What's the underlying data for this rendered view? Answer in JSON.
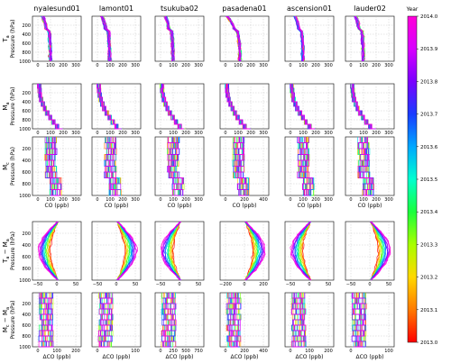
{
  "chart_data": {
    "type": "line",
    "sites": [
      "nyalesund01",
      "lamont01",
      "tsukuba02",
      "pasadena01",
      "ascension01",
      "lauder02"
    ],
    "rows": [
      {
        "key": "Ta",
        "ylabel_top": "T",
        "ylabel_sub": "a",
        "ylabel_main": "Pressure (hPa)",
        "xlabel": "",
        "kind": "smooth",
        "xlim": [
          [
            0,
            350
          ],
          [
            0,
            350
          ],
          [
            0,
            350
          ],
          [
            0,
            350
          ],
          [
            0,
            350
          ],
          [
            0,
            350
          ]
        ],
        "xticks": [
          [
            0,
            100,
            200,
            300
          ],
          [
            0,
            100,
            200,
            300
          ],
          [
            0,
            100,
            200,
            300
          ],
          [
            0,
            100,
            200,
            300
          ],
          [
            0,
            100,
            200,
            300
          ],
          [
            0,
            100,
            200,
            300
          ]
        ]
      },
      {
        "key": "Ma",
        "ylabel_top": "M",
        "ylabel_sub": "a",
        "ylabel_main": "Pressure (hPa)",
        "xlabel": "",
        "kind": "step",
        "xlim": [
          [
            0,
            350
          ],
          [
            0,
            350
          ],
          [
            0,
            350
          ],
          [
            0,
            350
          ],
          [
            0,
            350
          ],
          [
            0,
            350
          ]
        ],
        "xticks": [
          [
            0,
            100,
            200,
            300
          ],
          [
            0,
            100,
            200,
            300
          ],
          [
            0,
            100,
            200,
            300
          ],
          [
            0,
            100,
            200,
            300
          ],
          [
            0,
            100,
            200,
            300
          ],
          [
            0,
            100,
            200,
            300
          ]
        ]
      },
      {
        "key": "Mc",
        "ylabel_top": "M",
        "ylabel_sub": "c",
        "ylabel_main": "Pressure (hPa)",
        "xlabel": "CO (ppb)",
        "kind": "step",
        "xlim": [
          [
            0,
            350
          ],
          [
            0,
            350
          ],
          [
            0,
            350
          ],
          [
            0,
            350
          ],
          [
            0,
            350
          ],
          [
            0,
            350
          ]
        ],
        "xticks": [
          [
            "0",
            "100",
            "200",
            "300"
          ],
          [
            "0",
            "100",
            "200",
            "300"
          ],
          [
            "0",
            "100",
            "200",
            "300"
          ],
          [
            "0",
            "200",
            "400"
          ],
          [
            "0",
            "100",
            "200",
            "300"
          ],
          [
            "0",
            "100",
            "200",
            "300"
          ]
        ]
      },
      {
        "key": "Ta-Ma",
        "ylabel_top": "T",
        "ylabel_sub": "a",
        "ylabel_extra": "− M",
        "ylabel_sub2": "a",
        "ylabel_main": "Pressure (hPa)",
        "xlabel": "",
        "kind": "smooth",
        "xlim": [
          [
            -70,
            70
          ],
          [
            -70,
            70
          ],
          [
            -70,
            70
          ],
          [
            -300,
            300
          ],
          [
            -70,
            70
          ],
          [
            -70,
            70
          ]
        ],
        "xticks": [
          [
            "−50",
            "0",
            "50"
          ],
          [
            "−50",
            "0",
            "50"
          ],
          [
            "−50",
            "0",
            "50"
          ],
          [
            "−200",
            "0",
            "200"
          ],
          [
            "−50",
            "0",
            "50"
          ],
          [
            "−50",
            "0",
            "50"
          ]
        ]
      },
      {
        "key": "Mc-Ma",
        "ylabel_top": "M",
        "ylabel_sub": "c",
        "ylabel_extra": "− M",
        "ylabel_sub2": "a",
        "ylabel_main": "Pressure (hPa)",
        "xlabel": "ΔCO (ppb)",
        "kind": "step",
        "xlim": [
          [
            -70,
            350
          ],
          [
            -70,
            350
          ],
          [
            -70,
            350
          ],
          [
            -300,
            500
          ],
          [
            -70,
            350
          ],
          [
            -70,
            350
          ]
        ],
        "xticks": [
          [
            "0",
            "100",
            "200"
          ],
          [
            "0",
            "100"
          ],
          [
            "0",
            "250",
            "500",
            "750"
          ],
          [
            "0",
            "200",
            "400"
          ],
          [
            "0",
            "100",
            "200"
          ],
          [
            "0",
            "100"
          ]
        ]
      }
    ],
    "yticks": [
      200,
      400,
      600,
      800,
      1000
    ],
    "ylim": [
      1000,
      0
    ],
    "grid": true,
    "colorbar": {
      "label": "Year",
      "min": 2013.0,
      "max": 2014.0,
      "ticks": [
        "2014.0",
        "2013.9",
        "2013.8",
        "2013.7",
        "2013.6",
        "2013.5",
        "2013.4",
        "2013.3",
        "2013.2",
        "2013.1",
        "2013.0"
      ],
      "colormap": [
        "#ff0000",
        "#ff7a00",
        "#ffd800",
        "#a8ff00",
        "#1aff3c",
        "#00ffd0",
        "#00a8ff",
        "#1a3cff",
        "#7a00ff",
        "#d800ff",
        "#ff00d8"
      ]
    }
  }
}
